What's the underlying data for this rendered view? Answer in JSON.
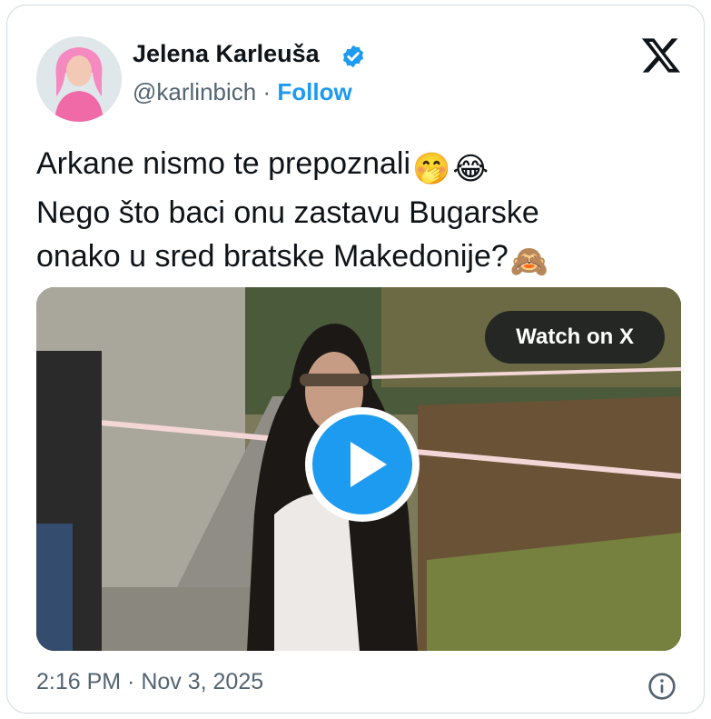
{
  "author": {
    "name": "Jelena Karleuša",
    "handle": "@karlinbich",
    "separator": "·",
    "follow_label": "Follow",
    "verified_icon": "verified-badge-icon",
    "accent_color": "#1d9bf0"
  },
  "tweet": {
    "lines": [
      "Arkane nismo te prepoznali",
      "Nego što baci onu zastavu Bugarske",
      "onako u sred bratske Makedonije?"
    ],
    "emojis": [
      "🤭",
      "😂",
      "🙈"
    ]
  },
  "media": {
    "watch_label": "Watch on X",
    "play_icon": "play-icon"
  },
  "footer": {
    "timestamp": "2:16 PM · Nov 3, 2025",
    "info_icon": "info-icon"
  },
  "brand": {
    "logo": "x-logo-icon"
  }
}
